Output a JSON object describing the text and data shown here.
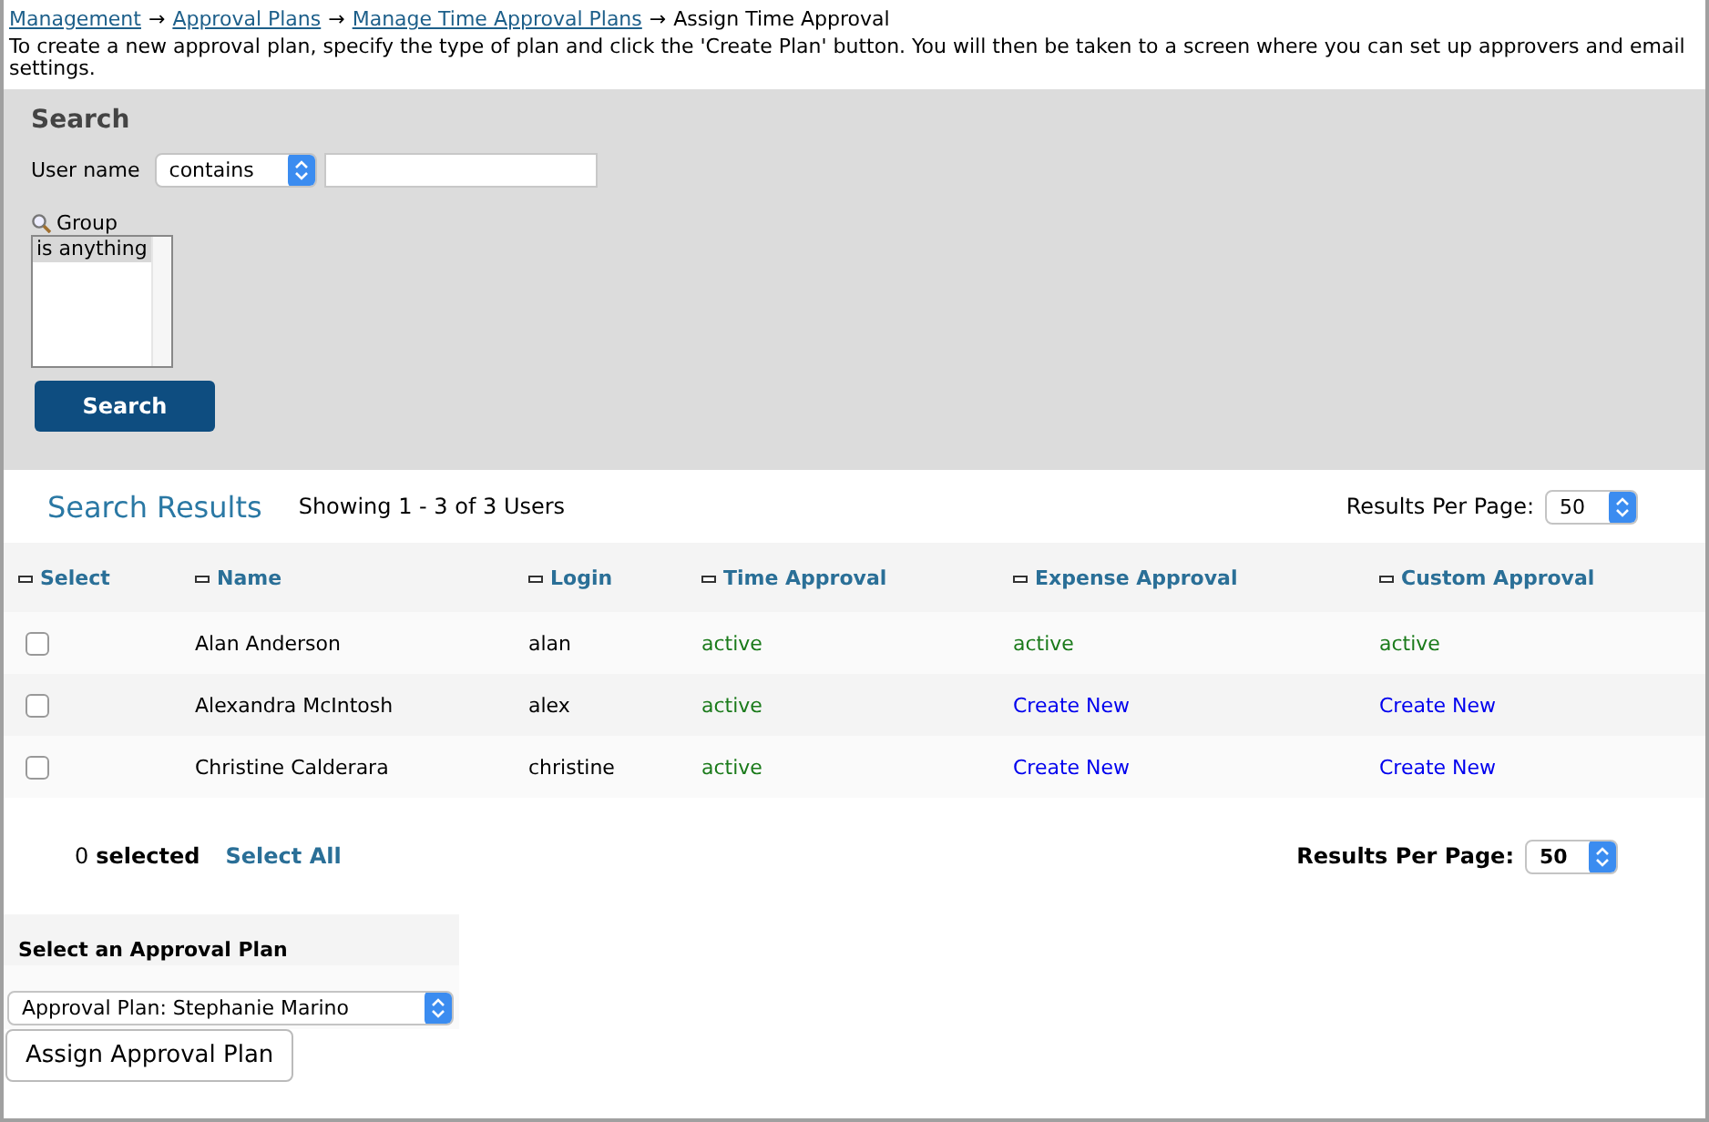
{
  "breadcrumb": [
    {
      "kind": "link",
      "label": "Management"
    },
    {
      "kind": "separator",
      "label": "→"
    },
    {
      "kind": "link",
      "label": "Approval Plans"
    },
    {
      "kind": "separator",
      "label": "→"
    },
    {
      "kind": "link",
      "label": "Manage Time Approval Plans"
    },
    {
      "kind": "separator",
      "label": "→"
    },
    {
      "kind": "current",
      "label": "Assign Time Approval"
    }
  ],
  "description": "To create a new approval plan, specify the type of plan and click the 'Create Plan' button. You will then be taken to a screen where you can set up approvers and email settings.",
  "search": {
    "title": "Search",
    "user_name": {
      "label": "User name",
      "operator": "contains"
    },
    "group": {
      "label": "Group",
      "options": [
        {
          "label": "is anything",
          "selected": true
        }
      ]
    },
    "button": "Search"
  },
  "results": {
    "title": "Search Results",
    "summary": "Showing 1 - 3 of 3 Users",
    "per_page_label": "Results Per Page:",
    "per_page": "50",
    "columns": [
      "Select",
      "Name",
      "Login",
      "Time Approval",
      "Expense Approval",
      "Custom Approval"
    ],
    "rows": [
      {
        "checked": false,
        "name": "Alan Anderson",
        "login": "alan",
        "cells": [
          {
            "kind": "status",
            "text": "active"
          },
          {
            "kind": "status",
            "text": "active"
          },
          {
            "kind": "status",
            "text": "active"
          }
        ]
      },
      {
        "checked": false,
        "name": "Alexandra McIntosh",
        "login": "alex",
        "cells": [
          {
            "kind": "status",
            "text": "active"
          },
          {
            "kind": "link",
            "text": "Create New"
          },
          {
            "kind": "link",
            "text": "Create New"
          }
        ]
      },
      {
        "checked": false,
        "name": "Christine Calderara",
        "login": "christine",
        "cells": [
          {
            "kind": "status",
            "text": "active"
          },
          {
            "kind": "link",
            "text": "Create New"
          },
          {
            "kind": "link",
            "text": "Create New"
          }
        ]
      }
    ],
    "selected_count": "0",
    "selected_label": "selected",
    "select_all": "Select All",
    "bottom_per_page_label": "Results Per Page:",
    "bottom_per_page": "50"
  },
  "approval_plan": {
    "title": "Select an Approval Plan",
    "plan": "Approval Plan: Stephanie Marino",
    "button": "Assign Approval Plan"
  }
}
